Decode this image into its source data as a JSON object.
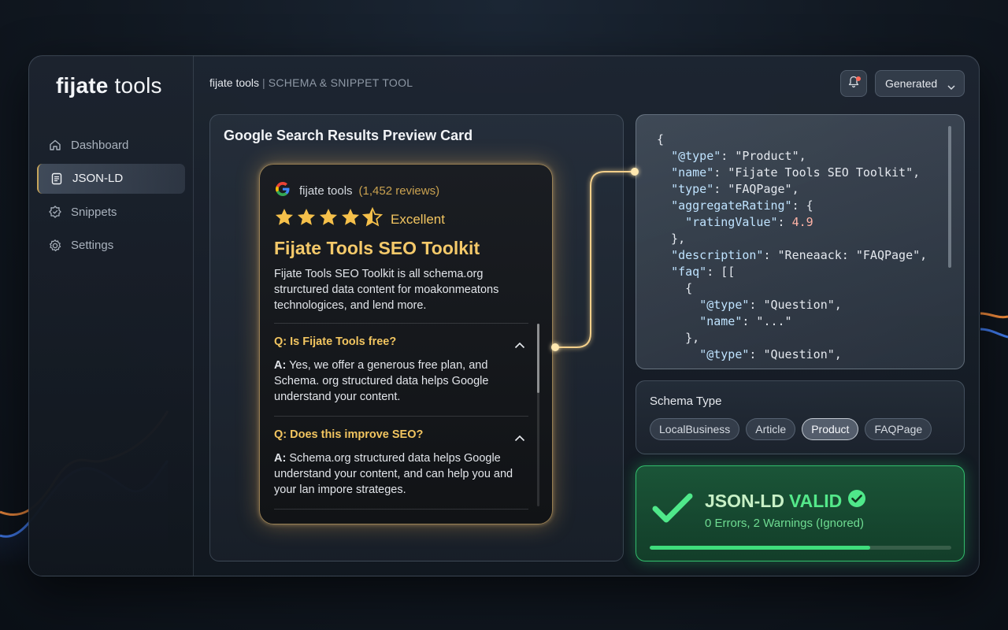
{
  "app": {
    "logo": {
      "bold": "fijate",
      "light": " tools"
    },
    "topbar": {
      "product": "fijate tools",
      "separator": "|",
      "subtitle": "SCHEMA & SNIPPET TOOL"
    },
    "dropdown": {
      "value": "Generated",
      "icon": "chevron-down-icon"
    },
    "notification_icon": "bell-icon"
  },
  "sidebar": {
    "items": [
      {
        "label": "Dashboard",
        "icon": "home-icon",
        "active": false
      },
      {
        "label": "JSON-LD",
        "icon": "document-icon",
        "active": true
      },
      {
        "label": "Snippets",
        "icon": "badge-icon",
        "active": false
      },
      {
        "label": "Settings",
        "icon": "gear-icon",
        "active": false
      }
    ]
  },
  "preview": {
    "title": "Google Search Results Preview Card",
    "card": {
      "site": "fijate tools",
      "reviews": "(1,452 reviews)",
      "rating_stars": 4.5,
      "rating_label": "Excellent",
      "title": "Fijate Tools SEO Toolkit",
      "description": "Fijate Tools SEO Toolkit is all schema.org strurctured data content for moakonmeatons technologices, and lend more.",
      "faq": [
        {
          "q": "Q: Is Fijate Tools free?",
          "a_prefix": "A:",
          "a": " Yes, we offer a generous free plan, and Schema. org structured data helps Google understand your content."
        },
        {
          "q": "Q: Does this improve SEO?",
          "a_prefix": "A:",
          "a": " Schema.org structured data helps Google understand your content, and can help you and your lan impore strateges."
        }
      ]
    }
  },
  "code": {
    "lines": [
      "{",
      "  \"@type\": \"Product\",",
      "  \"name\": \"Fijate Tools SEO Toolkit\",",
      "  \"type\": \"FAQPage\",",
      "  \"aggregateRating\": {",
      "    \"ratingValue\": 4.9",
      "  },",
      "  \"description\": \"Reneaack: \"FAQPage\",",
      "  \"faq\": [[",
      "    {",
      "      \"@type\": \"Question\",",
      "      \"name\": \"...\"",
      "    },",
      "      \"@type\": \"Question\","
    ]
  },
  "schema": {
    "label": "Schema Type",
    "types": [
      "LocalBusiness",
      "Article",
      "Product",
      "FAQPage"
    ],
    "selected": "Product"
  },
  "validation": {
    "title_prefix": "JSON-LD",
    "title_status": "VALID",
    "summary": "0 Errors, 2 Warnings (Ignored)",
    "progress_percent": 73,
    "color": "#3fdc7c"
  }
}
